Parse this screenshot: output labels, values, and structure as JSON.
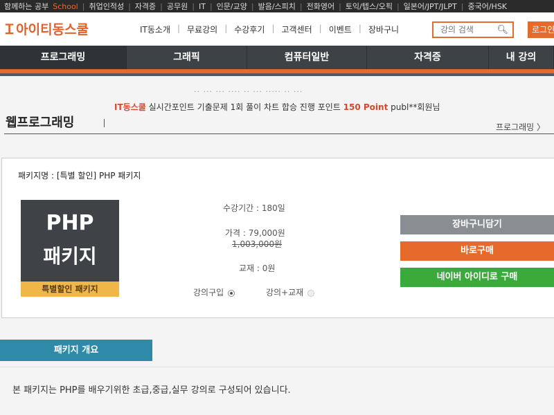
{
  "topbar": {
    "items": [
      "함께하는 공부",
      "School",
      "취업인적성",
      "자격증",
      "공무원",
      "IT",
      "인문/교양",
      "발음/스피치",
      "전화영어",
      "토익/텝스/오픽",
      "일본어/JPT/JLPT",
      "중국어/HSK"
    ]
  },
  "header": {
    "logo": "아이티동스쿨",
    "nav": [
      "IT동소개",
      "무료강의",
      "수강후기",
      "고객센터",
      "이벤트",
      "장바구니"
    ],
    "search_placeholder": "강의 검색",
    "login": "로그인"
  },
  "mainnav": {
    "tabs": [
      "프로그래밍",
      "그래픽",
      "컴퓨터일반",
      "자격증",
      "내 강의"
    ]
  },
  "notice": {
    "brand": "IT동스쿨",
    "text": "실시간포인트 기출문제 1회 풀이 차트 합승 진행 포인트",
    "points": "150 Point",
    "user": "publ**회원님"
  },
  "page": {
    "title": "웹프로그래밍",
    "breadcrumb": "프로그래밍 〉"
  },
  "package": {
    "name_label": "패키지명 : [특별 할인] PHP 패키지",
    "thumb_line1": "PHP",
    "thumb_line2": "패키지",
    "thumb_ribbon": "특별할인 패키지",
    "period": "수강기간 : 180일",
    "price": "가격 : 79,000원",
    "original_price": "1,003,000원",
    "textbook": "교재 : 0원",
    "option_lecture": "강의구입",
    "option_lecture_book": "강의+교재",
    "btn_cart": "장바구니담기",
    "btn_buy": "바로구매",
    "btn_naver": "네이버 아이디로 구매"
  },
  "overview": {
    "tab": "패키지 개요",
    "description": "본 패키지는 PHP를 배우기위한 초급,중급,실무 강의로 구성되어 있습니다."
  },
  "colors": {
    "accent": "#e66a2c",
    "nav_bg": "#3d4247",
    "naver_green": "#3aaa3a",
    "overview_blue": "#2e8aa8"
  }
}
